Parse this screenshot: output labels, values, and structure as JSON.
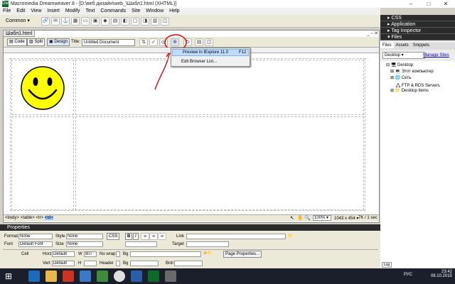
{
  "window": {
    "title": "Macromedia Dreamweaver 8 - [D:\\веб дизайн\\web_\\Шабл1.html (XHTML)]"
  },
  "menu": [
    "File",
    "Edit",
    "View",
    "Insert",
    "Modify",
    "Text",
    "Commands",
    "Site",
    "Window",
    "Help"
  ],
  "insertbar": {
    "category": "Common"
  },
  "document": {
    "tab": "Шабл1.html",
    "views": {
      "code": "Code",
      "split": "Split",
      "design": "Design"
    },
    "title_label": "Title:",
    "title_value": "Untitled Document"
  },
  "context_menu": {
    "preview": "Preview in IExplore 11.0",
    "preview_key": "F12",
    "edit": "Edit Browser List..."
  },
  "statusbar": {
    "tags": [
      "<body>",
      "<table>",
      "<tr>",
      "<td>"
    ],
    "zoom": "100%",
    "dims": "1043 x 454",
    "size": "7K / 1 sec"
  },
  "properties": {
    "header": "Properties",
    "format_label": "Format",
    "format_value": "None",
    "style_label": "Style",
    "style_value": "None",
    "css_btn": "CSS",
    "bold": "B",
    "italic": "I",
    "link_label": "Link",
    "font_label": "Font",
    "font_value": "Default Font",
    "size_label": "Size",
    "size_value": "None",
    "target_label": "Target",
    "cell_label": "Cell",
    "horz_label": "Horz",
    "horz_value": "Default",
    "w_label": "W",
    "w_value": "807",
    "nowrap_label": "No wrap",
    "bg_label": "Bg",
    "pageprops_btn": "Page Properties...",
    "vert_label": "Vert",
    "vert_value": "Default",
    "h_label": "H",
    "header_label": "Header",
    "brdr_label": "Brdr"
  },
  "panels": {
    "css": "CSS",
    "application": "Application",
    "tag": "Tag Inspector",
    "files": "Files"
  },
  "files": {
    "tabs": [
      "Files",
      "Assets",
      "Snippets"
    ],
    "location": "Desktop",
    "manage": "Manage Sites",
    "tree": [
      "Desktop",
      "Этот компьютер",
      "Сеть",
      "FTP & RDS Servers",
      "Desktop items"
    ]
  },
  "taskbar": {
    "lang": "РУС",
    "time": "23:42",
    "date": "08.10.2015"
  }
}
